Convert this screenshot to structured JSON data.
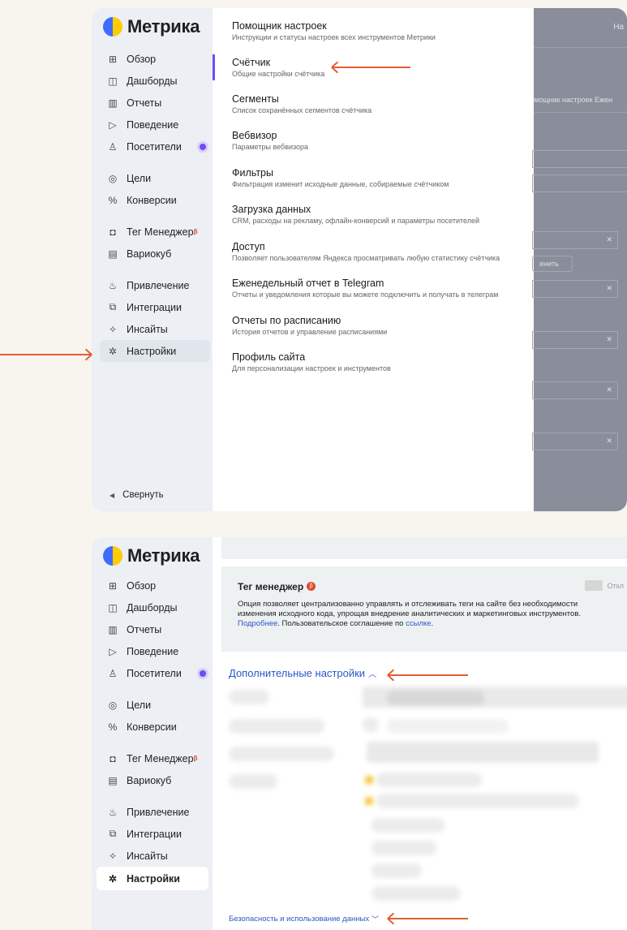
{
  "top": {
    "logo": "Метрика",
    "overlay_header_text": "На",
    "overlay_tab_text": "мощник настроек   Ежен",
    "overlay_button_text": "енить",
    "collapse_label": "Свернуть",
    "nav": [
      {
        "label": "Обзор",
        "icon": "grid-icon"
      },
      {
        "label": "Дашборды",
        "icon": "dashboard-icon"
      },
      {
        "label": "Отчеты",
        "icon": "bar-chart-icon"
      },
      {
        "label": "Поведение",
        "icon": "play-icon"
      },
      {
        "label": "Посетители",
        "icon": "user-icon"
      },
      {
        "label": "Цели",
        "icon": "target-icon"
      },
      {
        "label": "Конверсии",
        "icon": "percent-icon"
      },
      {
        "label": "Тег Менеджер",
        "beta": "β",
        "icon": "tag-icon"
      },
      {
        "label": "Вариокуб",
        "icon": "table-icon"
      },
      {
        "label": "Привлечение",
        "icon": "flame-icon"
      },
      {
        "label": "Интеграции",
        "icon": "puzzle-icon"
      },
      {
        "label": "Инсайты",
        "icon": "sparkle-icon"
      },
      {
        "label": "Настройки",
        "icon": "gear-icon"
      }
    ],
    "menu": [
      {
        "title": "Помощник настроек",
        "desc": "Инструкции и статусы настроек всех инструментов Метрики"
      },
      {
        "title": "Счётчик",
        "desc": "Общие настройки счётчика"
      },
      {
        "title": "Сегменты",
        "desc": "Список сохранённых сегментов счётчика"
      },
      {
        "title": "Вебвизор",
        "desc": "Параметры вебвизора"
      },
      {
        "title": "Фильтры",
        "desc": "Фильтрация изменит исходные данные, собираемые счётчиком"
      },
      {
        "title": "Загрузка данных",
        "desc": "CRM, расходы на рекламу, офлайн-конверсий и параметры посетителей"
      },
      {
        "title": "Доступ",
        "desc": "Позволяет пользователям Яндекса просматривать любую статистику счётчика"
      },
      {
        "title": "Еженедельный отчет в Telegram",
        "desc": "Отчеты и уведомления которые вы можете подключить и получать в телеграм"
      },
      {
        "title": "Отчеты по расписанию",
        "desc": "История отчетов и управление расписаниями"
      },
      {
        "title": "Профиль сайта",
        "desc": "Для персонализации настроек и инструментов"
      }
    ]
  },
  "bottom": {
    "logo": "Метрика",
    "tag_manager": {
      "title": "Тег менеджер",
      "badge": "β",
      "toggle_label": "Откл",
      "desc_main": "Опция позволяет централизованно управлять и отслеживать теги на сайте без необходимости изменения исходного кода, упрощая внедрение аналитических и маркетинговых инструментов.",
      "more_link": "Подробнее",
      "agreement_text": ". Пользовательское соглашение по",
      "agreement_link": "ссылке",
      "end": "."
    },
    "advanced_settings": "Дополнительные настройки",
    "security_link": "Безопасность и использование данных"
  },
  "colors": {
    "accent": "#6f4cf5",
    "arrow": "#e35d33",
    "link": "#2a57c9",
    "beta": "#e0492a"
  }
}
